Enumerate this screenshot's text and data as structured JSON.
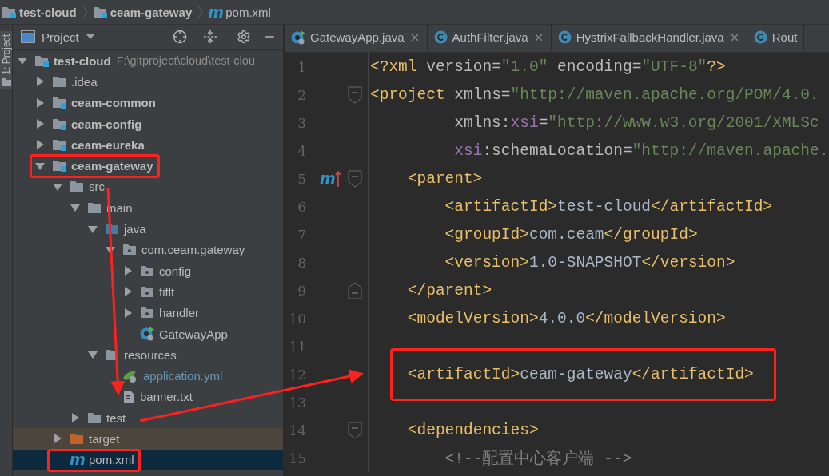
{
  "breadcrumb": [
    {
      "label": "test-cloud",
      "kind": "module"
    },
    {
      "label": "ceam-gateway",
      "kind": "module"
    },
    {
      "label": "pom.xml",
      "kind": "maven-file",
      "icon_text": "m"
    }
  ],
  "side_strip": {
    "label": "1: Project",
    "selected": true
  },
  "project_panel": {
    "title": "Project",
    "tree": [
      {
        "label": "test-cloud",
        "path": "F:\\gitproject\\cloud\\test-clou",
        "kind": "module",
        "expanded": true,
        "selected": false,
        "highlighted": false,
        "modified": false,
        "children": [
          {
            "label": ".idea",
            "kind": "folder",
            "expanded": false,
            "selected": false,
            "highlighted": false,
            "modified": false
          },
          {
            "label": "ceam-common",
            "kind": "module",
            "expanded": false,
            "selected": false,
            "highlighted": false,
            "modified": false
          },
          {
            "label": "ceam-config",
            "kind": "module",
            "expanded": false,
            "selected": false,
            "highlighted": false,
            "modified": false
          },
          {
            "label": "ceam-eureka",
            "kind": "module",
            "expanded": false,
            "selected": false,
            "highlighted": false,
            "modified": false
          },
          {
            "label": "ceam-gateway",
            "kind": "module",
            "expanded": true,
            "selected": false,
            "highlighted": true,
            "modified": false,
            "children": [
              {
                "label": "src",
                "kind": "folder",
                "expanded": true,
                "selected": false,
                "highlighted": false,
                "modified": false,
                "children": [
                  {
                    "label": "main",
                    "kind": "folder",
                    "expanded": true,
                    "selected": false,
                    "highlighted": false,
                    "modified": false,
                    "children": [
                      {
                        "label": "java",
                        "kind": "source-folder",
                        "expanded": true,
                        "selected": false,
                        "highlighted": false,
                        "modified": false,
                        "children": [
                          {
                            "label": "com.ceam.gateway",
                            "kind": "package",
                            "expanded": true,
                            "selected": false,
                            "highlighted": false,
                            "modified": false,
                            "children": [
                              {
                                "label": "config",
                                "kind": "package",
                                "expanded": false,
                                "selected": false,
                                "highlighted": false,
                                "modified": false
                              },
                              {
                                "label": "fiflt",
                                "kind": "package",
                                "expanded": false,
                                "selected": false,
                                "highlighted": false,
                                "modified": false
                              },
                              {
                                "label": "handler",
                                "kind": "package",
                                "expanded": false,
                                "selected": false,
                                "highlighted": false,
                                "modified": false
                              },
                              {
                                "label": "GatewayApp",
                                "kind": "app-class",
                                "selected": false,
                                "highlighted": false,
                                "modified": false
                              }
                            ]
                          }
                        ]
                      },
                      {
                        "label": "resources",
                        "kind": "resources-folder",
                        "expanded": true,
                        "selected": false,
                        "highlighted": false,
                        "modified": false,
                        "children": [
                          {
                            "label": "application.yml",
                            "kind": "yml-file",
                            "selected": false,
                            "highlighted": false,
                            "modified": true
                          },
                          {
                            "label": "banner.txt",
                            "kind": "text-file",
                            "selected": false,
                            "highlighted": false,
                            "modified": false
                          }
                        ]
                      }
                    ]
                  },
                  {
                    "label": "test",
                    "kind": "folder",
                    "expanded": false,
                    "selected": false,
                    "highlighted": false,
                    "modified": false
                  }
                ]
              },
              {
                "label": "target",
                "kind": "excluded-folder",
                "expanded": false,
                "selected": false,
                "highlighted": false,
                "modified": false
              },
              {
                "label": "pom.xml",
                "kind": "maven-file",
                "icon_text": "m",
                "selected": true,
                "highlighted": true,
                "modified": false
              }
            ]
          }
        ]
      }
    ]
  },
  "editor_tabs": [
    {
      "label": "GatewayApp.java",
      "kind": "app-class",
      "selected": false,
      "closable": true
    },
    {
      "label": "AuthFilter.java",
      "kind": "class",
      "selected": false,
      "closable": true
    },
    {
      "label": "HystrixFallbackHandler.java",
      "kind": "class",
      "selected": false,
      "closable": true
    },
    {
      "label": "Rout",
      "kind": "class",
      "selected": false,
      "closable": false
    }
  ],
  "editor": {
    "lines": [
      {
        "number": "1",
        "tokens": [
          {
            "kind": "tag",
            "text": "<?xml "
          },
          {
            "kind": "attr",
            "text": "version="
          },
          {
            "kind": "value",
            "text": "\"1.0\""
          },
          {
            "kind": "attr",
            "text": " encoding="
          },
          {
            "kind": "value",
            "text": "\"UTF-8\""
          },
          {
            "kind": "tag",
            "text": "?>"
          }
        ]
      },
      {
        "number": "2",
        "fold": {
          "kind": "start"
        },
        "tokens": [
          {
            "kind": "tag",
            "text": "<project "
          },
          {
            "kind": "attr",
            "text": "xmlns="
          },
          {
            "kind": "value",
            "text": "\"http://maven.apache.org/POM/4.0."
          }
        ]
      },
      {
        "number": "3",
        "tokens": [
          {
            "kind": "attr",
            "text": "         xmlns:"
          },
          {
            "kind": "ns",
            "text": "xsi"
          },
          {
            "kind": "attr",
            "text": "="
          },
          {
            "kind": "value",
            "text": "\"http://www.w3.org/2001/XMLSc"
          }
        ]
      },
      {
        "number": "4",
        "tokens": [
          {
            "kind": "ns",
            "text": "         xsi"
          },
          {
            "kind": "attr",
            "text": ":schemaLocation="
          },
          {
            "kind": "value",
            "text": "\"http://maven.apache."
          }
        ]
      },
      {
        "number": "5",
        "fold": {
          "kind": "start"
        },
        "gutter_text": "m",
        "tokens": [
          {
            "kind": "tag",
            "text": "    <parent>"
          }
        ]
      },
      {
        "number": "6",
        "tokens": [
          {
            "kind": "tag",
            "text": "        <artifactId>"
          },
          {
            "kind": "text",
            "text": "test-cloud"
          },
          {
            "kind": "tag",
            "text": "</artifactId>"
          }
        ]
      },
      {
        "number": "7",
        "tokens": [
          {
            "kind": "tag",
            "text": "        <groupId>"
          },
          {
            "kind": "text",
            "text": "com.ceam"
          },
          {
            "kind": "tag",
            "text": "</groupId>"
          }
        ]
      },
      {
        "number": "8",
        "tokens": [
          {
            "kind": "tag",
            "text": "        <version>"
          },
          {
            "kind": "text",
            "text": "1.0-SNAPSHOT"
          },
          {
            "kind": "tag",
            "text": "</version>"
          }
        ]
      },
      {
        "number": "9",
        "fold": {
          "kind": "end"
        },
        "tokens": [
          {
            "kind": "tag",
            "text": "    </parent>"
          }
        ]
      },
      {
        "number": "10",
        "tokens": [
          {
            "kind": "tag",
            "text": "    <modelVersion>"
          },
          {
            "kind": "text",
            "text": "4.0.0"
          },
          {
            "kind": "tag",
            "text": "</modelVersion>"
          }
        ]
      },
      {
        "number": "11"
      },
      {
        "number": "12",
        "highlighted": true,
        "tokens": [
          {
            "kind": "tag",
            "text": "    <artifactId>"
          },
          {
            "kind": "text",
            "text": "ceam-gateway"
          },
          {
            "kind": "tag",
            "text": "</artifactId>"
          }
        ]
      },
      {
        "number": "13"
      },
      {
        "number": "14",
        "fold": {
          "kind": "start"
        },
        "tokens": [
          {
            "kind": "tag",
            "text": "    <dependencies>"
          }
        ]
      },
      {
        "number": "15",
        "tokens": [
          {
            "kind": "comment",
            "text": "        <!--配置中心客户端 -->"
          }
        ]
      }
    ]
  },
  "annotation_arrows": [
    {
      "kind": "arrow"
    },
    {
      "kind": "arrow"
    }
  ]
}
